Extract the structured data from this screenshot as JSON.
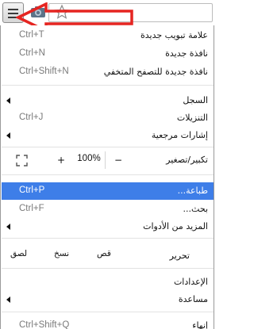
{
  "toolbar": {
    "menu_button_icon": "hamburger-icon",
    "camera_icon": "camera-icon",
    "star_icon": "star-icon",
    "annotation_arrow_color": "#e52521"
  },
  "menu": {
    "section1": [
      {
        "label": "علامة تبويب جديدة",
        "shortcut": "Ctrl+T"
      },
      {
        "label": "نافذة جديدة",
        "shortcut": "Ctrl+N"
      },
      {
        "label": "نافذة جديدة للتصفح المتخفي",
        "shortcut": "Ctrl+Shift+N"
      }
    ],
    "section2": [
      {
        "label": "السجل",
        "shortcut": ""
      },
      {
        "label": "التنزيلات",
        "shortcut": "Ctrl+J"
      },
      {
        "label": "إشارات مرجعية",
        "shortcut": ""
      }
    ],
    "zoom": {
      "label": "تكبير/تصغير",
      "minus": "−",
      "level": "100%",
      "plus": "+"
    },
    "section3": [
      {
        "label": "طباعة...",
        "shortcut": "Ctrl+P"
      },
      {
        "label": "بحث...",
        "shortcut": "Ctrl+F"
      },
      {
        "label": "المزيد من الأدوات",
        "shortcut": ""
      }
    ],
    "edit": {
      "label": "تحرير",
      "cut": "قص",
      "copy": "نسخ",
      "paste": "لصق"
    },
    "section4": [
      {
        "label": "الإعدادات",
        "shortcut": ""
      },
      {
        "label": "مساعدة",
        "shortcut": ""
      }
    ],
    "section5": [
      {
        "label": "إنهاء",
        "shortcut": "Ctrl+Shift+Q"
      }
    ],
    "highlight_color": "#3e7ee8"
  }
}
